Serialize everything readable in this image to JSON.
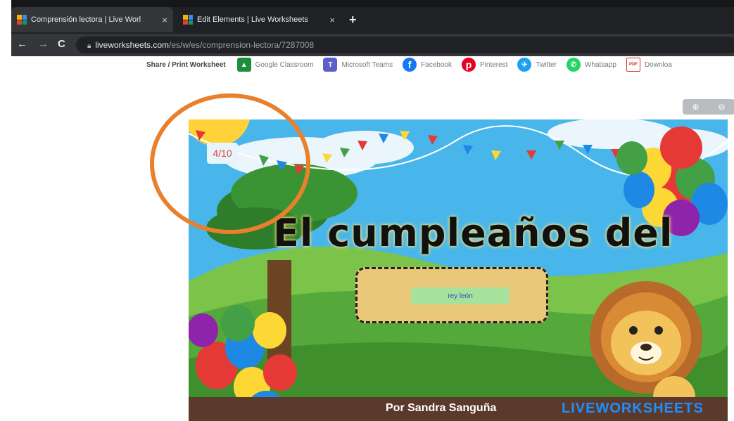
{
  "browser": {
    "tabs": [
      {
        "title": "Comprensión lectora | Live Worl",
        "active": true
      },
      {
        "title": "Edit Elements | Live Worksheets",
        "active": false
      }
    ],
    "new_tab": "+",
    "close_glyph": "×",
    "nav": {
      "back": "←",
      "forward": "→",
      "reload": "C"
    },
    "url_domain": "liveworksheets.com",
    "url_path": "/es/w/es/comprension-lectora/7287008"
  },
  "share": {
    "label": "Share / Print Worksheet",
    "items": [
      {
        "label": "Google Classroom",
        "icon": "google-classroom-icon",
        "color": "#1e8e3e",
        "glyph": "▲"
      },
      {
        "label": "Microsoft Teams",
        "icon": "microsoft-teams-icon",
        "color": "#5b5fc7",
        "glyph": "T"
      },
      {
        "label": "Facebook",
        "icon": "facebook-icon",
        "color": "#1877f2",
        "glyph": "f"
      },
      {
        "label": "Pinterest",
        "icon": "pinterest-icon",
        "color": "#e60023",
        "glyph": "p"
      },
      {
        "label": "Twitter",
        "icon": "twitter-icon",
        "color": "#1da1f2",
        "glyph": "✈"
      },
      {
        "label": "Whatsapp",
        "icon": "whatsapp-icon",
        "color": "#25d366",
        "glyph": "✆"
      },
      {
        "label": "Downloa",
        "icon": "pdf-icon",
        "color": "#d93025",
        "glyph": "PDF"
      }
    ]
  },
  "zoom": {
    "zoom_in": "⊕",
    "zoom_out": "⊖"
  },
  "worksheet": {
    "page_counter": "4/10",
    "title": "El cumpleaños del",
    "answer": "rey león",
    "author": "Por Sandra Sanguña",
    "brand": "LIVEWORKSHEETS"
  },
  "colors": {
    "sky": "#48b6ea",
    "grass": "#55a83a",
    "annotation": "#ea7f2c"
  }
}
